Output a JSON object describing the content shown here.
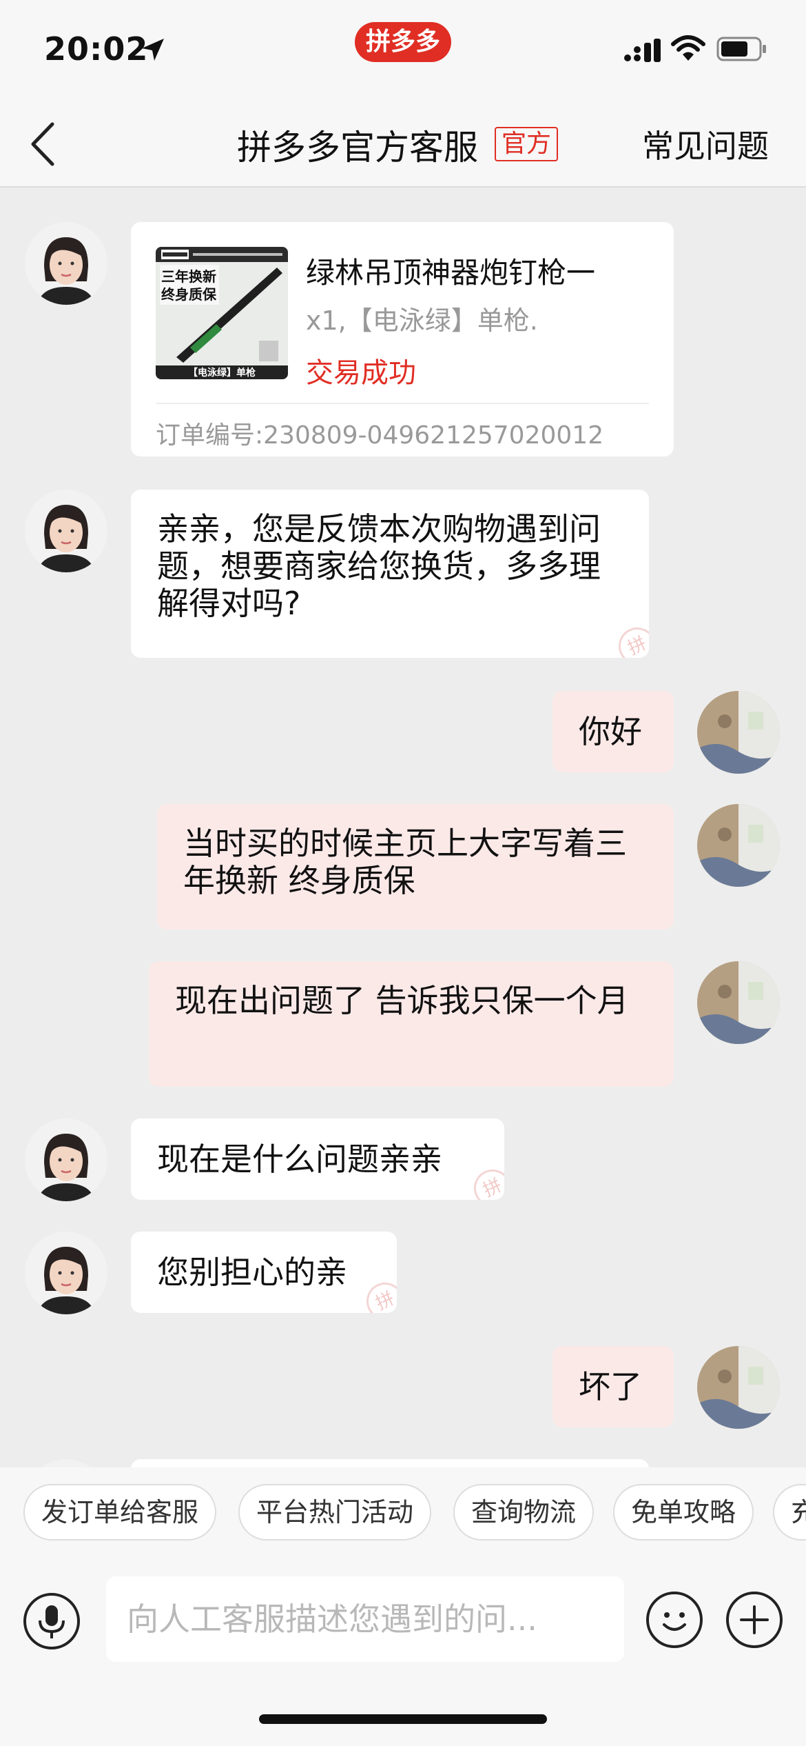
{
  "status_bar": {
    "time": "20:02"
  },
  "app_badge": "拼多多",
  "nav": {
    "title": "拼多多官方客服",
    "tag": "官方",
    "faq": "常见问题"
  },
  "order": {
    "image_lines": [
      "三年换新",
      "终身质保",
      "【电泳绿】单枪"
    ],
    "title": "绿林吊顶神器炮钉枪一",
    "spec": "x1,【电泳绿】单枪.",
    "status": "交易成功",
    "order_no": "订单编号:230809-049621257020012"
  },
  "messages": [
    {
      "side": "left",
      "text": "亲亲，您是反馈本次购物遇到问题，想要商家给您换货，多多理解得对吗?"
    },
    {
      "side": "right",
      "text": "你好"
    },
    {
      "side": "right",
      "text": "当时买的时候主页上大字写着三年换新 终身质保"
    },
    {
      "side": "right",
      "text": "现在出问题了 告诉我只保一个月"
    },
    {
      "side": "left",
      "text": "现在是什么问题亲亲"
    },
    {
      "side": "left",
      "text": "您别担心的亲"
    },
    {
      "side": "right",
      "text": "坏了"
    }
  ],
  "quick_replies": [
    "发订单给客服",
    "平台热门活动",
    "查询物流",
    "免单攻略",
    "充"
  ],
  "input": {
    "placeholder": "向人工客服描述您遇到的问..."
  },
  "watermark": "拼",
  "colors": {
    "brand": "#e02e24",
    "bubble_right": "#fbe9e8",
    "bubble_left": "#ffffff",
    "background": "#ededed"
  }
}
